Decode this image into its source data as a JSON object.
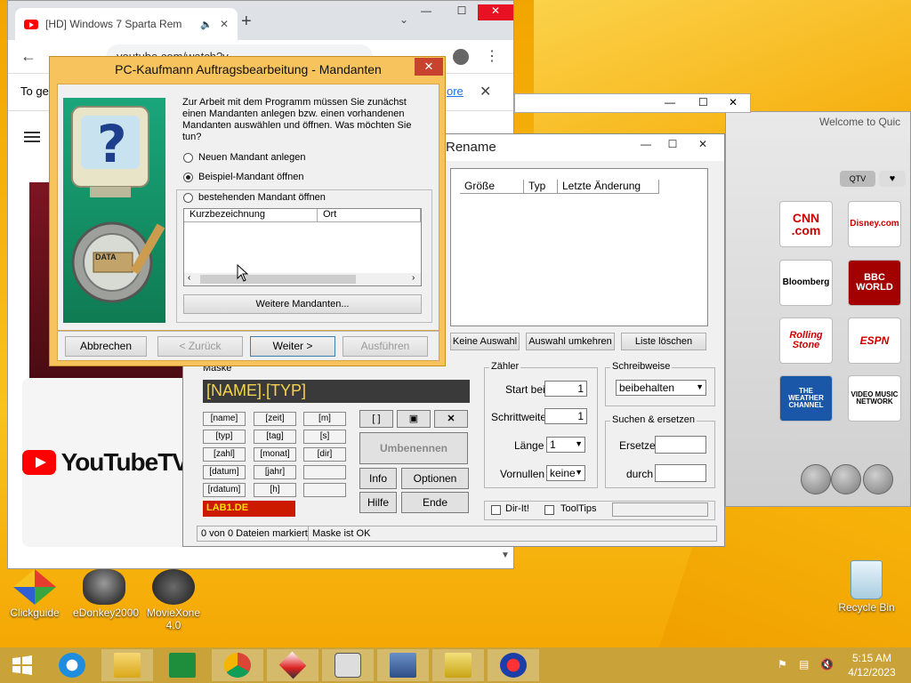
{
  "chrome": {
    "tab_title": "[HD] Windows 7 Sparta Rem",
    "new_tab": "+",
    "url": "youtube.com/watch?v...",
    "banner_text": "To ge",
    "banner_link": "ore"
  },
  "youtube": {
    "logo_text": "YouTubeTV"
  },
  "quicktime": {
    "title": "Welcome to Quic",
    "channels": [
      "CNN .com",
      "Disney.com",
      "Bloomberg",
      "BBC WORLD",
      "Rolling Stone",
      "ESPN",
      "THE WEATHER CHANNEL",
      "VIDEO MUSIC NETWORK"
    ]
  },
  "rename_app": {
    "title": "Rename",
    "columns": [
      "Größe",
      "Typ",
      "Letzte Änderung"
    ],
    "buttons": {
      "keine_auswahl": "Keine Auswahl",
      "auswahl_umkehren": "Auswahl umkehren",
      "liste_loeschen": "Liste löschen",
      "umbenennen": "Umbenennen",
      "info": "Info",
      "optionen": "Optionen",
      "hilfe": "Hilfe",
      "ende": "Ende",
      "brackets": "[ ]"
    },
    "mask_label": "Maske",
    "mask_value": "[NAME].[TYP]",
    "tokens": [
      "[name]",
      "[zeit]",
      "[m]",
      "[typ]",
      "[tag]",
      "[s]",
      "[zahl]",
      "[monat]",
      "[dir]",
      "[datum]",
      "[jahr]",
      "",
      "[rdatum]",
      "[h]",
      ""
    ],
    "counter": {
      "label": "Zähler",
      "start_label": "Start bei",
      "start_value": "1",
      "step_label": "Schrittweite",
      "step_value": "1",
      "length_label": "Länge",
      "length_value": "1",
      "zeros_label": "Vornullen",
      "zeros_value": "keine"
    },
    "case": {
      "label": "Schreibweise",
      "value": "beibehalten"
    },
    "search": {
      "label": "Suchen & ersetzen",
      "replace_label": "Ersetze",
      "with_label": "durch"
    },
    "dir_it": "Dir-It!",
    "tooltips": "ToolTips",
    "lab1": "LAB1.DE",
    "status_left": "0 von 0 Dateien markiert",
    "status_right": "Maske ist OK"
  },
  "dialog": {
    "title": "PC-Kaufmann Auftragsbearbeitung - Mandanten",
    "close": "✕",
    "intro": "Zur Arbeit mit dem Programm müssen Sie zunächst einen Mandanten anlegen bzw. einen vorhandenen Mandanten auswählen und öffnen. Was möchten Sie tun?",
    "option_new": "Neuen Mandant anlegen",
    "option_sample": "Beispiel-Mandant öffnen",
    "option_existing": "bestehenden Mandant öffnen",
    "col_short": "Kurzbezeichnung",
    "col_place": "Ort",
    "more_button": "Weitere Mandanten...",
    "data_label": "DATA",
    "footer": {
      "cancel": "Abbrechen",
      "back": "< Zurück",
      "next": "Weiter >",
      "run": "Ausführen"
    }
  },
  "desktop": {
    "icons": [
      "Clickguide",
      "eDonkey2000",
      "MovieXone 4.0",
      "Recycle Bin"
    ]
  },
  "taskbar": {
    "time": "5:15 AM",
    "date": "4/12/2023"
  }
}
